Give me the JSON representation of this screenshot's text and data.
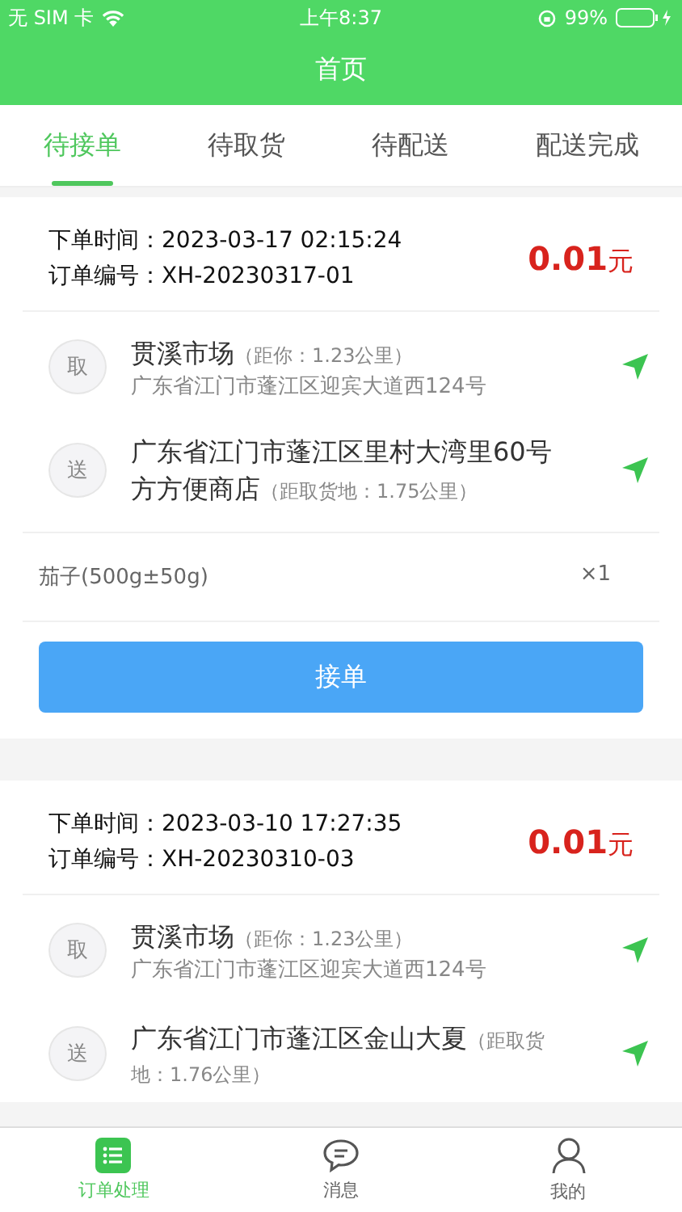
{
  "status_bar": {
    "carrier": "无 SIM 卡",
    "time": "上午8:37",
    "battery": "99%"
  },
  "header": {
    "title": "首页"
  },
  "tabs": [
    {
      "label": "待接单",
      "selected": true
    },
    {
      "label": "待取货",
      "selected": false
    },
    {
      "label": "待配送",
      "selected": false
    },
    {
      "label": "配送完成",
      "selected": false
    }
  ],
  "orders": [
    {
      "time_label": "下单时间：",
      "time": "2023-03-17 02:15:24",
      "number_label": "订单编号：",
      "number": "XH-20230317-01",
      "amount": "0.01",
      "unit": "元",
      "pickup": {
        "badge": "取",
        "name": "贯溪市场",
        "distance": "（距你：1.23公里）",
        "address": "广东省江门市蓬江区迎宾大道西124号"
      },
      "delivery": {
        "badge": "送",
        "name": "广东省江门市蓬江区里村大湾里60号方方便商店",
        "distance": "（距取货地：1.75公里）"
      },
      "items": [
        {
          "name": "茄子(500g±50g)",
          "qty": "×1"
        }
      ],
      "button": "接单"
    },
    {
      "time_label": "下单时间：",
      "time": "2023-03-10 17:27:35",
      "number_label": "订单编号：",
      "number": "XH-20230310-03",
      "amount": "0.01",
      "unit": "元",
      "pickup": {
        "badge": "取",
        "name": "贯溪市场",
        "distance": "（距你：1.23公里）",
        "address": "广东省江门市蓬江区迎宾大道西124号"
      },
      "delivery": {
        "badge": "送",
        "name": "广东省江门市蓬江区金山大夏",
        "distance": "（距取货地：1.76公里）"
      }
    }
  ],
  "tab_bar": [
    {
      "label": "订单处理",
      "kind": "list",
      "selected": true
    },
    {
      "label": "消息",
      "kind": "chat",
      "selected": false
    },
    {
      "label": "我的",
      "kind": "person",
      "selected": false
    }
  ]
}
